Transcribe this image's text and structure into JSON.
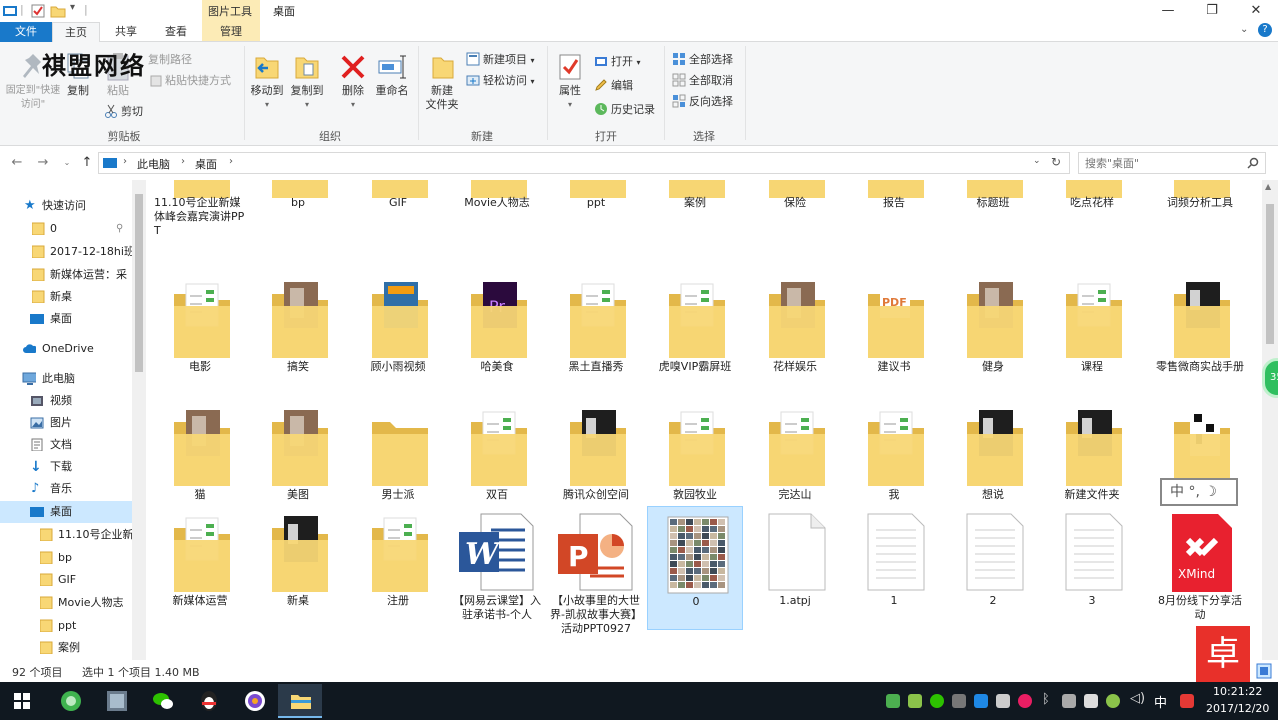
{
  "titlebar": {
    "context_tab_title": "图片工具",
    "window_title": "桌面",
    "minimize_glyph": "—",
    "maximize_glyph": "❐",
    "close_glyph": "✕"
  },
  "tabs": {
    "file": "文件",
    "home": "主页",
    "share": "共享",
    "view": "查看",
    "manage": "管理"
  },
  "ribbon": {
    "clipboard": {
      "label": "剪贴板",
      "pin_label": "固定到\"快速访问\"",
      "copy": "复制",
      "paste": "粘贴",
      "copy_path": "复制路径",
      "paste_shortcut": "粘贴快捷方式",
      "cut": "剪切"
    },
    "organize": {
      "label": "组织",
      "move_to": "移动到",
      "copy_to": "复制到",
      "delete": "删除",
      "rename": "重命名"
    },
    "new": {
      "label": "新建",
      "new_folder": "新建\n文件夹",
      "new_item": "新建项目",
      "easy_access": "轻松访问"
    },
    "open": {
      "label": "打开",
      "properties": "属性",
      "open": "打开",
      "edit": "编辑",
      "history": "历史记录"
    },
    "select": {
      "label": "选择",
      "select_all": "全部选择",
      "select_none": "全部取消",
      "invert": "反向选择"
    }
  },
  "watermark": "祺盟网络",
  "address": {
    "crumbs": [
      "此电脑",
      "桌面"
    ],
    "search_placeholder": "搜索\"桌面\""
  },
  "navpane": {
    "quick_access": "快速访问",
    "qa_items": [
      "0",
      "2017-12-18hi班",
      "新媒体运营：采",
      "新桌",
      "桌面"
    ],
    "onedrive": "OneDrive",
    "this_pc": "此电脑",
    "pc_items": [
      "视频",
      "图片",
      "文档",
      "下载",
      "音乐",
      "桌面"
    ],
    "desktop_items": [
      "11.10号企业新",
      "bp",
      "GIF",
      "Movie人物志",
      "ppt",
      "案例"
    ]
  },
  "files": [
    {
      "name": "11.10号企业新媒体峰会嘉宾演讲PPT",
      "kind": "folder-pdf"
    },
    {
      "name": "bp",
      "kind": "folder-doc"
    },
    {
      "name": "GIF",
      "kind": "folder-photo"
    },
    {
      "name": "Movie人物志",
      "kind": "folder"
    },
    {
      "name": "ppt",
      "kind": "folder-dark"
    },
    {
      "name": "案例",
      "kind": "folder-pdf"
    },
    {
      "name": "保险",
      "kind": "folder"
    },
    {
      "name": "报告",
      "kind": "folder-pdf"
    },
    {
      "name": "标题班",
      "kind": "folder-pdf"
    },
    {
      "name": "吃点花样",
      "kind": "folder-qr"
    },
    {
      "name": "词频分析工具",
      "kind": "folder"
    },
    {
      "name": "电影",
      "kind": "folder-doc"
    },
    {
      "name": "搞笑",
      "kind": "folder-photo"
    },
    {
      "name": "顾小雨视频",
      "kind": "folder-blue"
    },
    {
      "name": "哈美食",
      "kind": "folder-purple"
    },
    {
      "name": "黑土直播秀",
      "kind": "folder-doc"
    },
    {
      "name": "虎嗅VIP霸屏班",
      "kind": "folder-doc"
    },
    {
      "name": "花样娱乐",
      "kind": "folder-photo"
    },
    {
      "name": "建议书",
      "kind": "folder-pdf"
    },
    {
      "name": "健身",
      "kind": "folder-photo"
    },
    {
      "name": "课程",
      "kind": "folder-doc"
    },
    {
      "name": "零售微商实战手册",
      "kind": "folder-dark"
    },
    {
      "name": "猫",
      "kind": "folder-photo"
    },
    {
      "name": "美图",
      "kind": "folder-photo"
    },
    {
      "name": "男士派",
      "kind": "folder"
    },
    {
      "name": "双百",
      "kind": "folder-doc"
    },
    {
      "name": "腾讯众创空间",
      "kind": "folder-dark"
    },
    {
      "name": "敦园牧业",
      "kind": "folder-doc"
    },
    {
      "name": "完达山",
      "kind": "folder-doc"
    },
    {
      "name": "我",
      "kind": "folder-doc"
    },
    {
      "name": "想说",
      "kind": "folder-dark"
    },
    {
      "name": "新建文件夹",
      "kind": "folder-dark"
    },
    {
      "name": "",
      "kind": "folder-qr"
    },
    {
      "name": "新媒体运营",
      "kind": "folder-doc"
    },
    {
      "name": "新桌",
      "kind": "folder-dark"
    },
    {
      "name": "注册",
      "kind": "folder-doc"
    },
    {
      "name": "【网易云课堂】入驻承诺书-个人",
      "kind": "word"
    },
    {
      "name": "【小故事里的大世界-凯叔故事大赛】活动PPT0927",
      "kind": "ppt"
    },
    {
      "name": "0",
      "kind": "image"
    },
    {
      "name": "1.atpj",
      "kind": "blank"
    },
    {
      "name": "1",
      "kind": "text"
    },
    {
      "name": "2",
      "kind": "text"
    },
    {
      "name": "3",
      "kind": "text"
    },
    {
      "name": "8月份线下分享活动",
      "kind": "xmind"
    }
  ],
  "xmind_label": "XMind",
  "pdf_badge": "PDF",
  "ppt_badge": "P",
  "word_badge": "W",
  "status": {
    "count": "92 个项目",
    "selection": "选中 1 个项目  1.40 MB"
  },
  "taskbar": {
    "time": "10:21:22",
    "date": "2017/12/20",
    "ime": "中"
  },
  "overlays": {
    "ime_float": "中 °, ☽",
    "logo_stamp": "卓",
    "side_badge": "35"
  },
  "colors": {
    "accent": "#1979ca",
    "selection": "#cce8ff",
    "folder": "#f8d775",
    "folder_dark": "#e3b84a",
    "taskbar": "#101820"
  }
}
